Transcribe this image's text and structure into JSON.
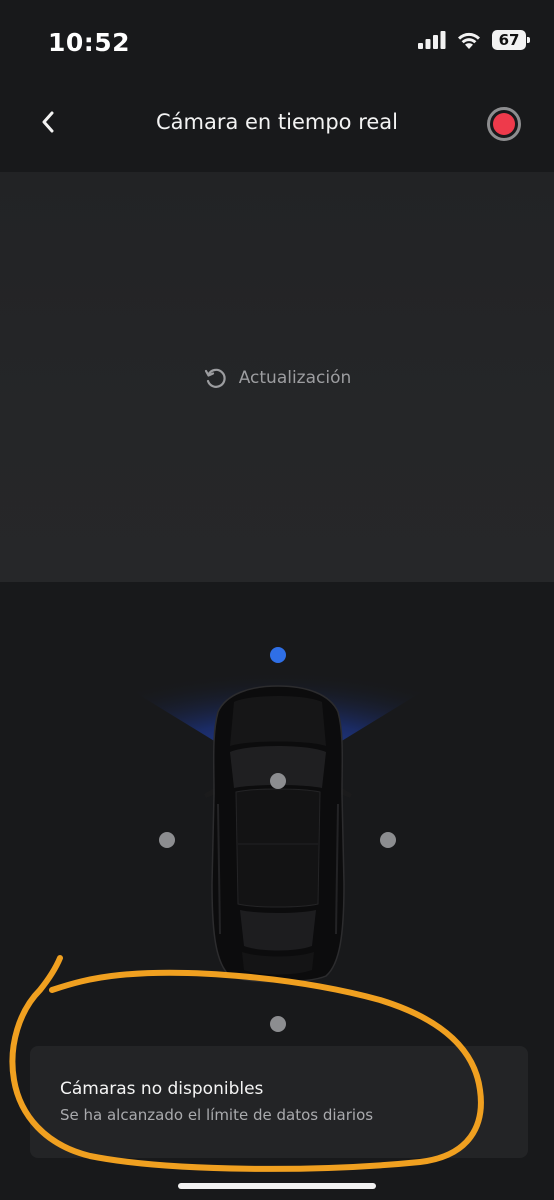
{
  "status_bar": {
    "time": "10:52",
    "battery": "67",
    "icons": [
      "signal-icon",
      "wifi-icon",
      "battery-icon"
    ]
  },
  "nav": {
    "title": "Cámara en tiempo real",
    "back_icon": "chevron-left-icon",
    "record_icon": "record-icon"
  },
  "camera_view": {
    "refresh_label": "Actualización",
    "refresh_icon": "refresh-icon"
  },
  "cameras": {
    "selected": "front",
    "positions": [
      "front",
      "cabin",
      "left",
      "right",
      "rear"
    ]
  },
  "notice": {
    "title": "Cámaras no disponibles",
    "subtitle": "Se ha alcanzado el límite de datos diarios"
  },
  "colors": {
    "background": "#18191b",
    "camera_view": "#242527",
    "accent_blue": "#2f6fe6",
    "record_red": "#ee3a4b",
    "annotation_orange": "#f0a020"
  }
}
